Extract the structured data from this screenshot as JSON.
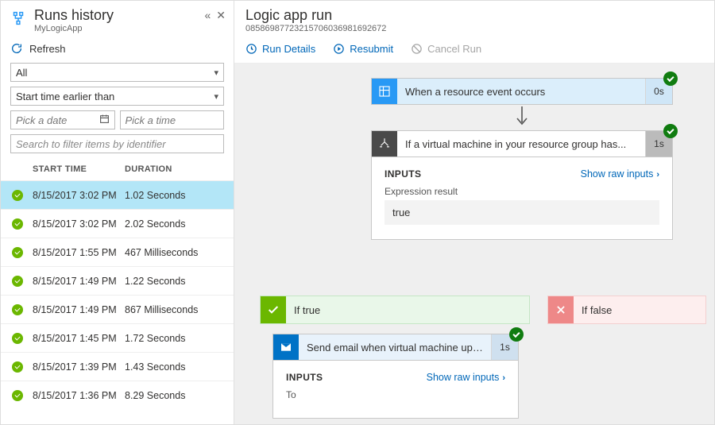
{
  "left": {
    "title": "Runs history",
    "subtitle": "MyLogicApp",
    "refresh": "Refresh",
    "filter_status": "All",
    "filter_time": "Start time earlier than",
    "date_placeholder": "Pick a date",
    "time_placeholder": "Pick a time",
    "search_placeholder": "Search to filter items by identifier",
    "col_start": "START TIME",
    "col_duration": "DURATION",
    "rows": [
      {
        "start": "8/15/2017 3:02 PM",
        "duration": "1.02 Seconds",
        "selected": true
      },
      {
        "start": "8/15/2017 3:02 PM",
        "duration": "2.02 Seconds"
      },
      {
        "start": "8/15/2017 1:55 PM",
        "duration": "467 Milliseconds"
      },
      {
        "start": "8/15/2017 1:49 PM",
        "duration": "1.22 Seconds"
      },
      {
        "start": "8/15/2017 1:49 PM",
        "duration": "867 Milliseconds"
      },
      {
        "start": "8/15/2017 1:45 PM",
        "duration": "1.72 Seconds"
      },
      {
        "start": "8/15/2017 1:39 PM",
        "duration": "1.43 Seconds"
      },
      {
        "start": "8/15/2017 1:36 PM",
        "duration": "8.29 Seconds"
      }
    ]
  },
  "right": {
    "title": "Logic app run",
    "run_id": "08586987723215706036981692672",
    "toolbar": {
      "details": "Run Details",
      "resubmit": "Resubmit",
      "cancel": "Cancel Run"
    },
    "step_trigger": {
      "label": "When a resource event occurs",
      "time": "0s"
    },
    "step_condition": {
      "label": "If a virtual machine in your resource group has...",
      "time": "1s"
    },
    "cond_panel": {
      "section": "INPUTS",
      "link": "Show raw inputs",
      "key": "Expression result",
      "value": "true"
    },
    "branch_true": "If true",
    "branch_false": "If false",
    "step_email": {
      "label": "Send email when virtual machine updat...",
      "time": "1s"
    },
    "email_panel": {
      "section": "INPUTS",
      "link": "Show raw inputs",
      "key": "To"
    }
  }
}
